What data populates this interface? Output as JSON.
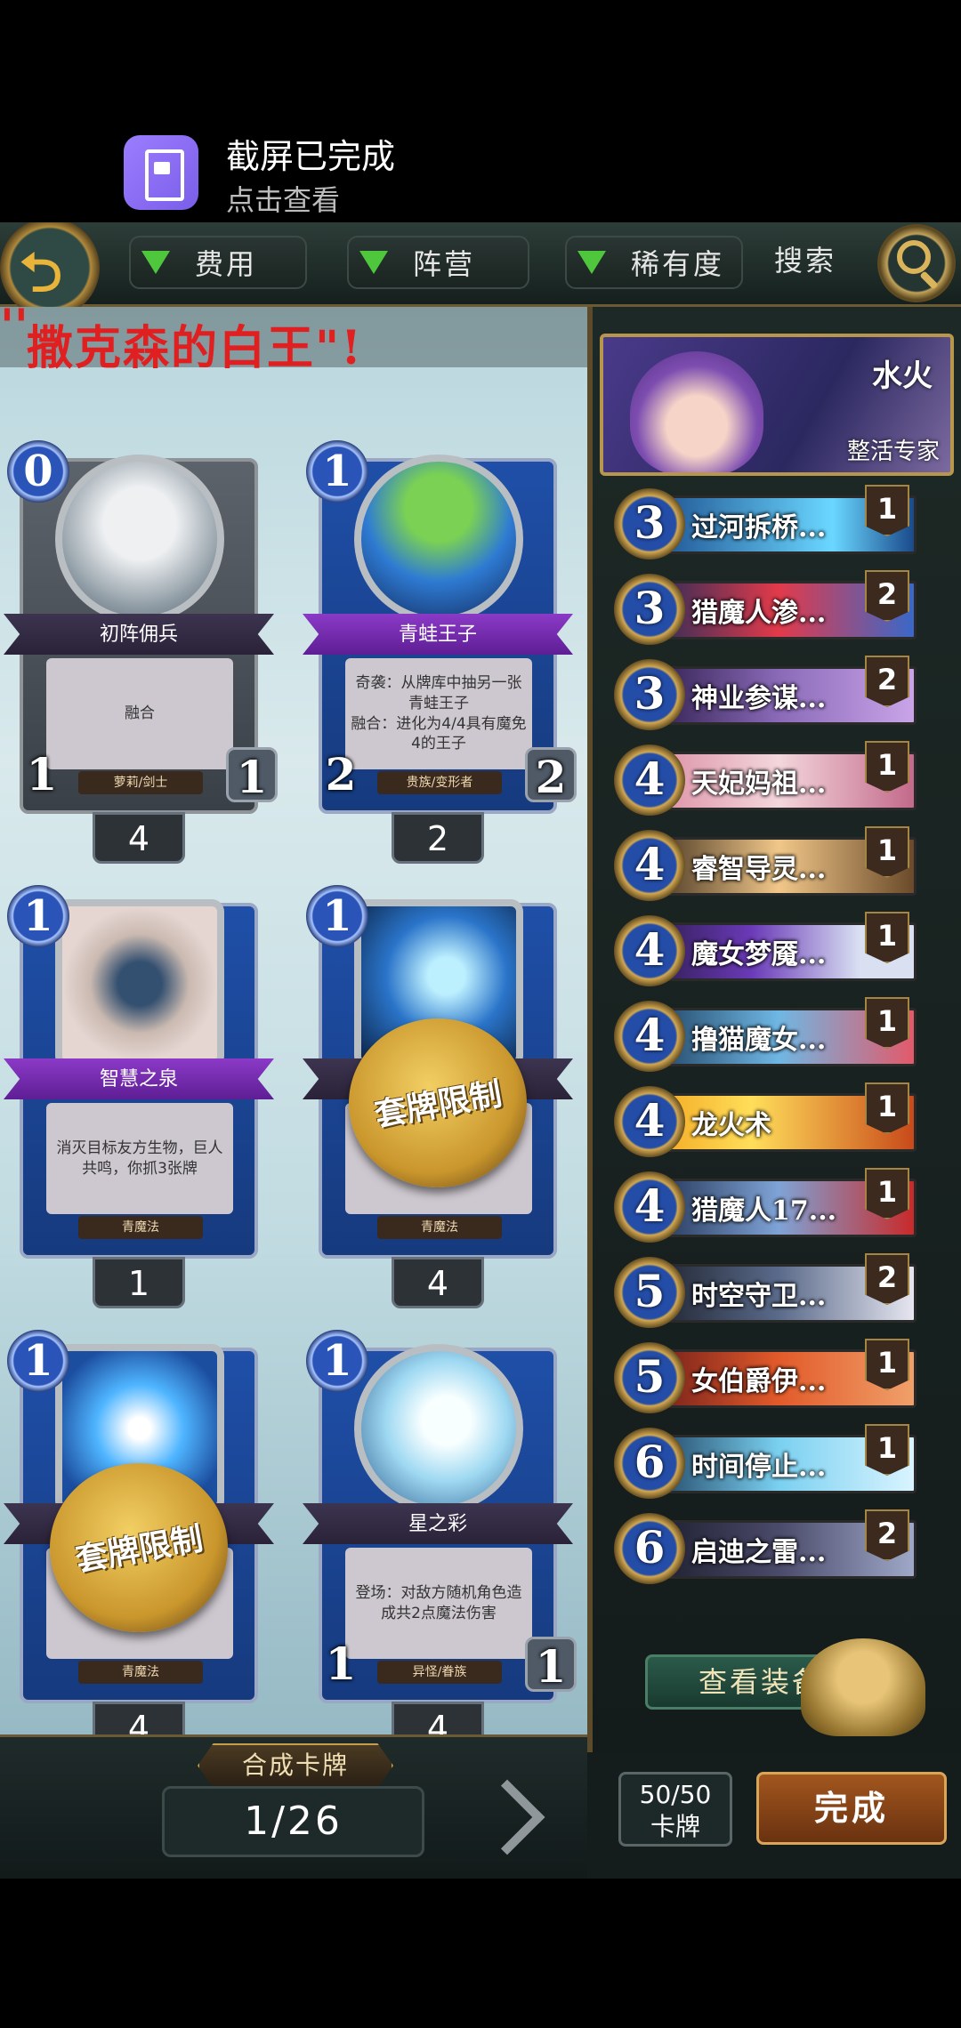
{
  "notification": {
    "title": "截屏已完成",
    "subtitle": "点击查看"
  },
  "topbar": {
    "filters": [
      {
        "label": "费用"
      },
      {
        "label": "阵营"
      },
      {
        "label": "稀有度"
      }
    ],
    "search_label": "搜索",
    "accent_color": "#4fc73c"
  },
  "deck_name": "撒克森的白王\"!",
  "cards": [
    {
      "cost": "0",
      "name": "初阵佣兵",
      "text": "融合",
      "type": "萝莉/剑士",
      "attack": "1",
      "health": "1",
      "count": "4",
      "icon": "girl-portrait"
    },
    {
      "cost": "1",
      "name": "青蛙王子",
      "text": "奇袭：从牌库中抽另一张青蛙王子\n融合：进化为4/4具有魔免4的王子",
      "type": "贵族/变形者",
      "attack": "2",
      "health": "2",
      "count": "2",
      "icon": "frog-portrait"
    },
    {
      "cost": "1",
      "name": "智慧之泉",
      "text": "消灭目标友方生物，巨人共鸣，你抓3张牌",
      "type": "青魔法",
      "count": "1",
      "icon": "eye-portrait"
    },
    {
      "cost": "1",
      "name": "",
      "text": "",
      "type": "青魔法",
      "count": "4",
      "seal": "套牌限制",
      "icon": "fairy-portrait"
    },
    {
      "cost": "1",
      "name": "",
      "text": "",
      "type": "青魔法",
      "count": "4",
      "seal": "套牌限制",
      "icon": "ice-portrait"
    },
    {
      "cost": "1",
      "name": "星之彩",
      "text": "登场：对敌方随机角色造成共2点魔法伤害",
      "type": "异怪/眷族",
      "attack": "1",
      "health": "1",
      "count": "4",
      "icon": "star-portrait"
    }
  ],
  "combine_label": "合成卡牌",
  "pager": "1/26",
  "deck": {
    "element": "水火",
    "archetype": "整活专家",
    "list": [
      {
        "cost": "3",
        "name": "过河拆桥...",
        "qty": "1"
      },
      {
        "cost": "3",
        "name": "猎魔人渗...",
        "qty": "2"
      },
      {
        "cost": "3",
        "name": "神业参谋...",
        "qty": "2"
      },
      {
        "cost": "4",
        "name": "天妃妈祖...",
        "qty": "1"
      },
      {
        "cost": "4",
        "name": "睿智导灵...",
        "qty": "1"
      },
      {
        "cost": "4",
        "name": "魔女梦魇...",
        "qty": "1"
      },
      {
        "cost": "4",
        "name": "撸猫魔女...",
        "qty": "1"
      },
      {
        "cost": "4",
        "name": "龙火术",
        "qty": "1"
      },
      {
        "cost": "4",
        "name": "猎魔人17...",
        "qty": "1"
      },
      {
        "cost": "5",
        "name": "时空守卫...",
        "qty": "2"
      },
      {
        "cost": "5",
        "name": "女伯爵伊...",
        "qty": "1"
      },
      {
        "cost": "6",
        "name": "时间停止...",
        "qty": "1"
      },
      {
        "cost": "6",
        "name": "启迪之雷...",
        "qty": "2"
      }
    ]
  },
  "equip_label": "查看装备",
  "card_count": {
    "value": "50/50",
    "label": "卡牌"
  },
  "done_label": "完成"
}
